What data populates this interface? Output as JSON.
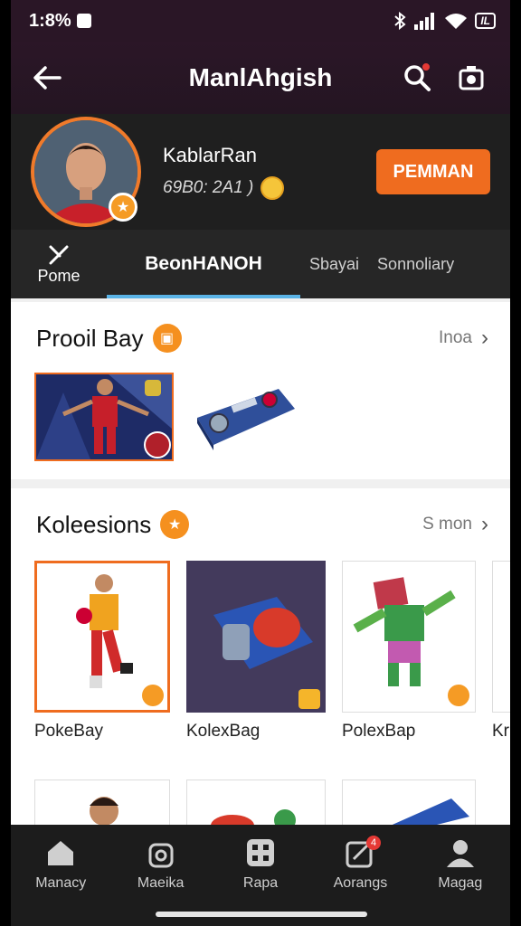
{
  "status_bar": {
    "time": "1:8%",
    "battery": "IL"
  },
  "header": {
    "title": "ManlAhgish"
  },
  "profile": {
    "name": "KablarRan",
    "stats": "69B0: 2A1 )",
    "premium_button": "PEMMAN"
  },
  "tabs": [
    {
      "label": "Pome"
    },
    {
      "label": "BeonHANOH"
    },
    {
      "label": "Sbayai"
    },
    {
      "label": "Sonnoliary"
    }
  ],
  "section_profile_bag": {
    "title": "Prooil Bay",
    "more_label": "Inoa"
  },
  "section_collections": {
    "title": "Koleesions",
    "more_label": "S mon",
    "items": [
      {
        "label": "PokeBay"
      },
      {
        "label": "KolexBag"
      },
      {
        "label": "PolexBap"
      },
      {
        "label": "Kr"
      }
    ]
  },
  "bottom_nav": [
    {
      "label": "Manacy",
      "icon": "home-icon"
    },
    {
      "label": "Maeika",
      "icon": "bag-icon"
    },
    {
      "label": "Rapa",
      "icon": "grid-icon"
    },
    {
      "label": "Aorangs",
      "icon": "edit-icon",
      "badge": "4"
    },
    {
      "label": "Magag",
      "icon": "person-icon"
    }
  ],
  "colors": {
    "accent": "#ef6c1f",
    "tab_indicator": "#5ab3e6",
    "header_bg": "#2b1627"
  }
}
